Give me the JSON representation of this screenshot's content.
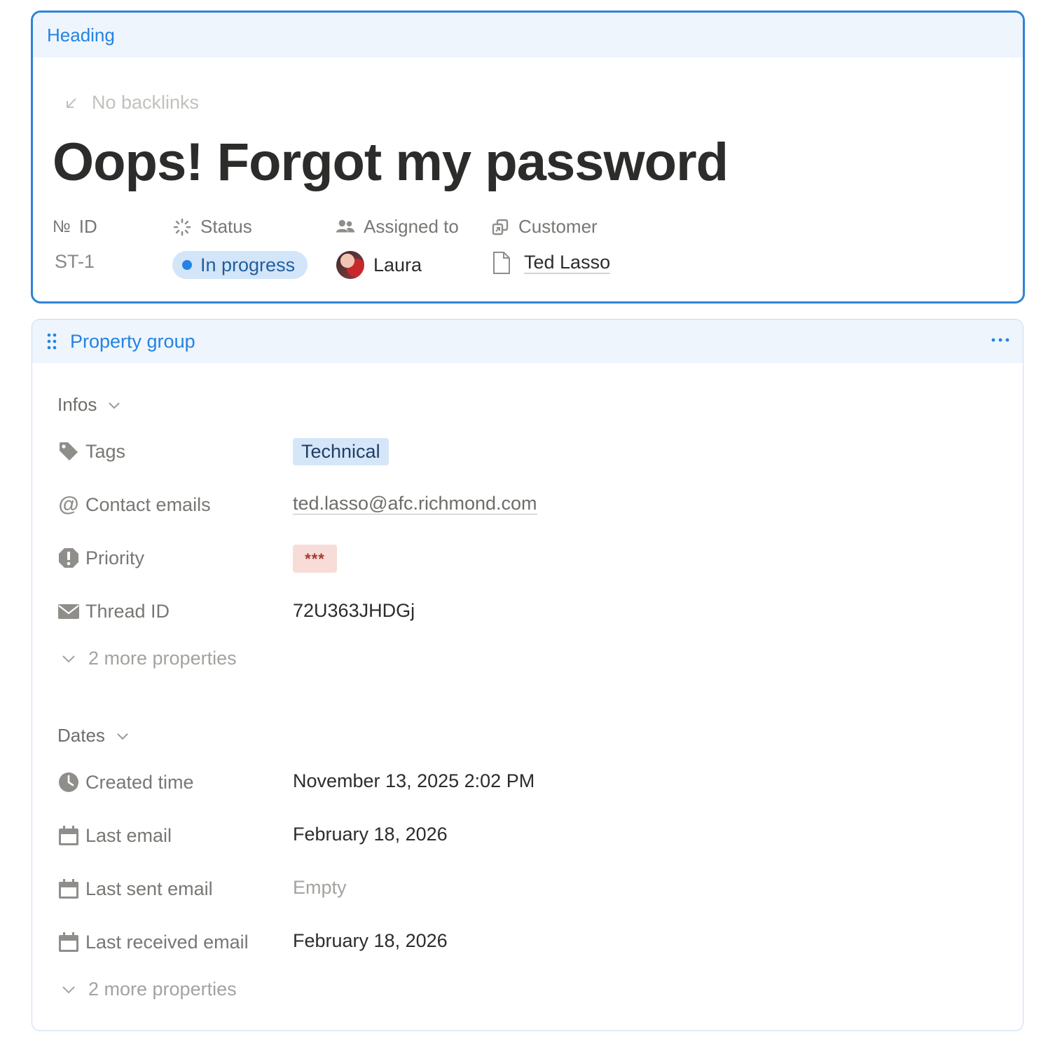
{
  "heading_block": {
    "label": "Heading",
    "backlinks": "No backlinks",
    "title": "Oops! Forgot my password",
    "properties": {
      "id": {
        "label": "ID",
        "value": "ST-1",
        "icon": "number-icon"
      },
      "status": {
        "label": "Status",
        "value": "In progress",
        "icon": "status-spinner-icon",
        "color": "#2383e2"
      },
      "assigned_to": {
        "label": "Assigned to",
        "value": "Laura",
        "icon": "people-icon"
      },
      "customer": {
        "label": "Customer",
        "value": "Ted Lasso",
        "icon": "relation-icon"
      }
    }
  },
  "property_group": {
    "label": "Property group",
    "sections": {
      "infos": {
        "label": "Infos",
        "rows": {
          "tags": {
            "label": "Tags",
            "value": "Technical"
          },
          "contact_emails": {
            "label": "Contact emails",
            "value": "ted.lasso@afc.richmond.com"
          },
          "priority": {
            "label": "Priority",
            "value": "***"
          },
          "thread_id": {
            "label": "Thread ID",
            "value": "72U363JHDGj"
          }
        },
        "more": "2 more properties"
      },
      "dates": {
        "label": "Dates",
        "rows": {
          "created_time": {
            "label": "Created time",
            "value": "November 13, 2025 2:02 PM"
          },
          "last_email": {
            "label": "Last email",
            "value": "February 18, 2026"
          },
          "last_sent_email": {
            "label": "Last sent email",
            "value": "Empty"
          },
          "last_received_email": {
            "label": "Last received email",
            "value": "February 18, 2026"
          }
        },
        "more": "2 more properties"
      }
    }
  },
  "colors": {
    "accent": "#2383e2",
    "header_bg": "#eef5fd",
    "tag_bg": "#d6e6f9",
    "priority_bg": "#f8dcd8"
  }
}
